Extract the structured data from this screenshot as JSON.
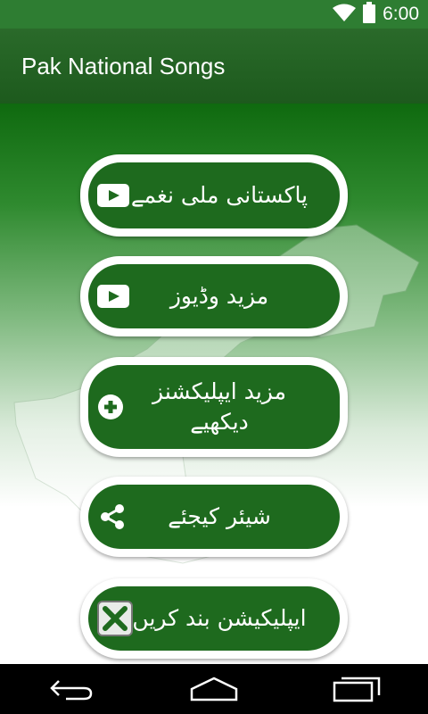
{
  "status_bar": {
    "time": "6:00"
  },
  "app_bar": {
    "title": "Pak National Songs"
  },
  "menu": [
    {
      "label": "پاکستانی ملی نغمے",
      "icon": "play-icon"
    },
    {
      "label": "مزید وڈیوز",
      "icon": "play-icon"
    },
    {
      "label": "مزید ایپلیکشنز دیکھیے",
      "icon": "plus-circle-icon"
    },
    {
      "label": "شیئر کیجئے",
      "icon": "share-icon"
    },
    {
      "label": "ایپلیکیشن بند کریں",
      "icon": "close-box-icon"
    }
  ],
  "colors": {
    "primary": "#1e6a1e",
    "status": "#2e7d32"
  }
}
